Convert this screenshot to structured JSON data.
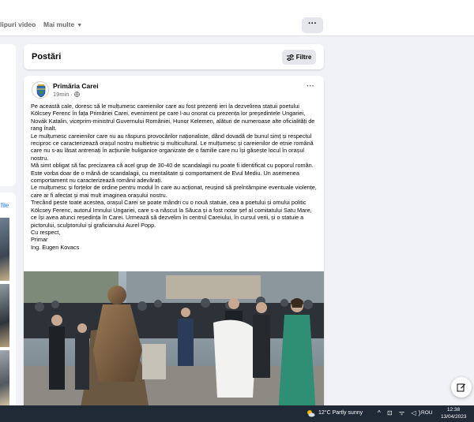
{
  "tabs": {
    "video_label": "lipuri video",
    "more_label": "Mai multe",
    "more_chevron": "▼",
    "options_label": "···"
  },
  "left": {
    "link_fragment": "file"
  },
  "posts": {
    "title": "Postări",
    "filter_label": "Filtre"
  },
  "post": {
    "author": "Primăria Carei",
    "time": "19min",
    "audience_icon": "globe-icon",
    "menu": "···",
    "paragraphs": [
      "Pe această cale, doresc să le mulțumesc careienilor care au fost prezenți ieri la dezvelirea statuii poetului Kölcsey Ferenc în fața Primăriei Carei, eveniment pe care l-au onorat cu prezența lor președintele Ungariei, Novák Katalin, viceprim-ministrul Guvernului României, Hunor Kelemen, alături de numeroase alte oficialități de rang înalt.",
      "Le mulțumesc careienilor care nu au răspuns provocărilor naționaliste, dând dovadă de bunul simț și respectul reciproc ce caracterizează orașul nostru multietnic și multicultural. Le mulțumesc și careienilor de etnie română care nu s-au lăsat antrenați în acțiunile huliganice organizate de o familie care nu își găsește locul în orașul nostru.",
      "Mă simt obligat să fac precizarea că acel grup de 30-40 de scandalagii nu poate fi identificat cu poporul român. Este vorba doar de o mână de scandalagii, cu mentalitate și comportament de Evul Mediu. Un asemenea comportament nu caracterizează românii adevărați.",
      "Le mulțumesc și forțelor de ordine pentru modul în care au acționat, reușind să preîntâmpine eventuale violențe, care ar fi afectat și mai mult imaginea orașului nostru.",
      "Trecând peste toate acestea, orașul Carei se poate mândri cu o nouă statuie, cea a poetului și omului politic Kölcsey Ferenc, autorul Imnului Ungariei, care s-a născut la Săuca și a fost notar șef al comitatului Satu Mare, ce își avea atunci reședința în Carei. Urmează să dezvelim în centrul Careiului, în cursul verii, și o statuie a pictorului, sculptorului și graficianului Aurel Popp.",
      "Cu respect,",
      "Primar",
      "Ing. Eugen Kovacs"
    ]
  },
  "taskbar": {
    "weather": "12°C  Partly sunny",
    "tray_icons": "^ ⊡ ᯤ ◁)",
    "lang": "ROU",
    "time": "12:38",
    "date": "13/04/2023"
  },
  "colors": {
    "accent": "#1877f2",
    "page_bg": "#f0f2f5",
    "taskbar_bg": "#1f2a36"
  }
}
